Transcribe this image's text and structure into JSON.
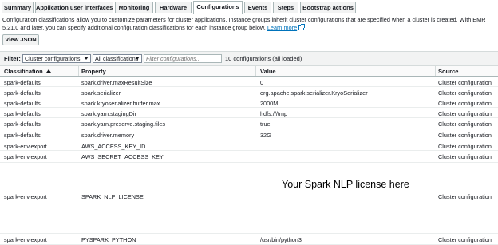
{
  "tabs": [
    {
      "label": "Summary",
      "active": false
    },
    {
      "label": "Application user interfaces",
      "active": false
    },
    {
      "label": "Monitoring",
      "active": false
    },
    {
      "label": "Hardware",
      "active": false
    },
    {
      "label": "Configurations",
      "active": true
    },
    {
      "label": "Events",
      "active": false
    },
    {
      "label": "Steps",
      "active": false
    },
    {
      "label": "Bootstrap actions",
      "active": false
    }
  ],
  "description": {
    "text": "Configuration classifications allow you to customize parameters for cluster applications. Instance groups inherit cluster configurations that are specified when a cluster is created. With EMR 5.21.0 and later, you can specify additional configuration classifications for each instance group below.",
    "link": "Learn more"
  },
  "view_json_label": "View JSON",
  "filter": {
    "label": "Filter:",
    "scope_value": "Cluster configurations",
    "classification_value": "All classifications",
    "search_placeholder": "Filter configurations...",
    "count_text": "10 configurations (all loaded)"
  },
  "table": {
    "headers": [
      "Classification",
      "Property",
      "Value",
      "Source"
    ],
    "rows": [
      {
        "classification": "spark-defaults",
        "property": "spark.driver.maxResultSize",
        "value": "0",
        "source": "Cluster configuration"
      },
      {
        "classification": "spark-defaults",
        "property": "spark.serializer",
        "value": "org.apache.spark.serializer.KryoSerializer",
        "source": "Cluster configuration"
      },
      {
        "classification": "spark-defaults",
        "property": "spark.kryoserializer.buffer.max",
        "value": "2000M",
        "source": "Cluster configuration"
      },
      {
        "classification": "spark-defaults",
        "property": "spark.yarn.stagingDir",
        "value": "hdfs:///tmp",
        "source": "Cluster configuration"
      },
      {
        "classification": "spark-defaults",
        "property": "spark.yarn.preserve.staging.files",
        "value": "true",
        "source": "Cluster configuration"
      },
      {
        "classification": "spark-defaults",
        "property": "spark.driver.memory",
        "value": "32G",
        "source": "Cluster configuration"
      },
      {
        "classification": "spark-env.export",
        "property": "AWS_ACCESS_KEY_ID",
        "value": "",
        "source": "Cluster configuration"
      },
      {
        "classification": "spark-env.export",
        "property": "AWS_SECRET_ACCESS_KEY",
        "value": "",
        "source": "Cluster configuration"
      },
      {
        "classification": "spark-env.export",
        "property": "SPARK_NLP_LICENSE",
        "value": "",
        "source": "Cluster configuration"
      },
      {
        "classification": "spark-env.export",
        "property": "PYSPARK_PYTHON",
        "value": "/usr/bin/python3",
        "source": "Cluster configuration"
      }
    ]
  },
  "overlay_text": "Your Spark NLP license here",
  "colors": {
    "link": "#0073bb",
    "border": "#aab7b8",
    "tab_bg": "#f2f3f3"
  },
  "icons": {
    "external_link": "external-link-icon",
    "sort": "sort-ascending-icon",
    "dropdown": "chevron-down-icon"
  }
}
